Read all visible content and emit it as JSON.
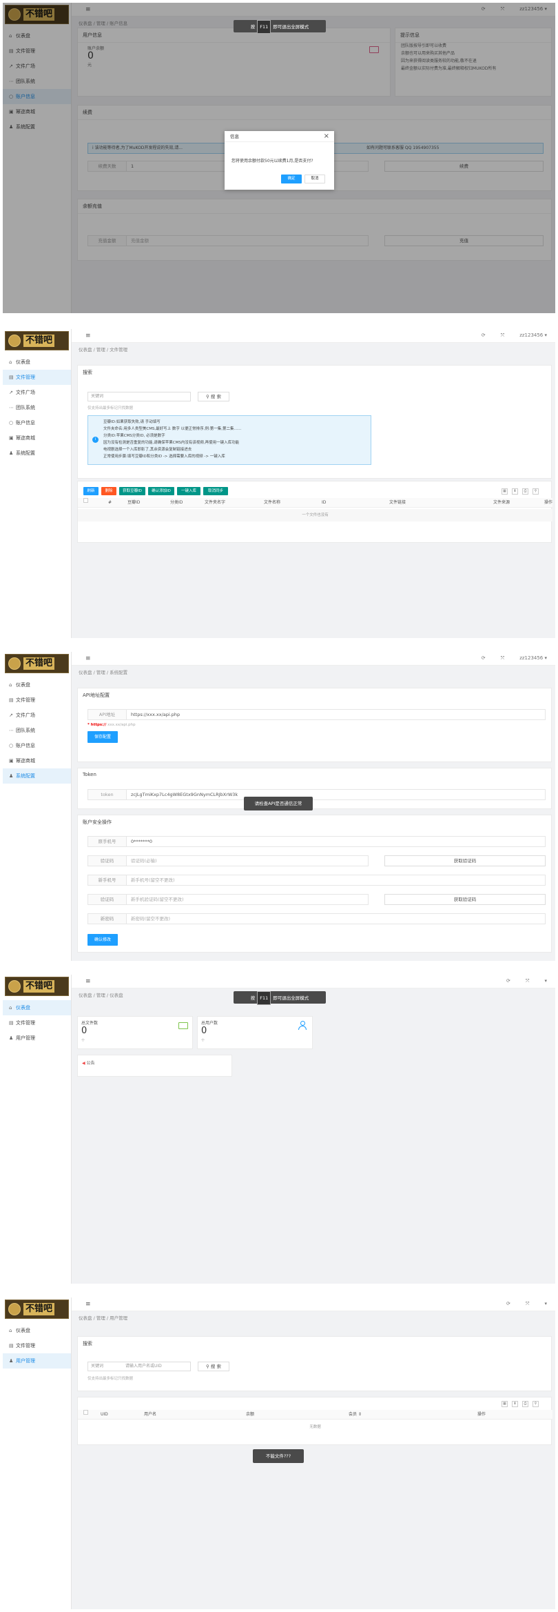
{
  "brand": {
    "logo_text": "不错吧",
    "logo_sub": "BUCUOBA.COM"
  },
  "topbar": {
    "menu_glyph": "≡",
    "refresh_glyph": "⟳",
    "fullscreen_glyph": "⤧",
    "user": "zz123456 ▾",
    "user_short": "▾"
  },
  "fullscreen_toast": {
    "pre": "按",
    "key": "F11",
    "post": "即可退出全屏模式"
  },
  "nav_full": [
    {
      "icon": "⌂",
      "label": "仪表盘"
    },
    {
      "icon": "▤",
      "label": "文件管理"
    },
    {
      "icon": "↗",
      "label": "文件广场"
    },
    {
      "icon": "⋯",
      "label": "团队系统"
    },
    {
      "icon": "○",
      "label": "账户信息"
    },
    {
      "icon": "▣",
      "label": "幂迩商城"
    },
    {
      "icon": "♟",
      "label": "系统配置"
    }
  ],
  "nav_short": [
    {
      "icon": "⌂",
      "label": "仪表盘"
    },
    {
      "icon": "▤",
      "label": "文件管理"
    },
    {
      "icon": "♟",
      "label": "用户管理"
    }
  ],
  "p1": {
    "crumb": "仪表盘 / 管理 / 账户信息",
    "user_info": {
      "title": "用户信息",
      "balance_label": "账户余额",
      "balance": "0",
      "unit": "元"
    },
    "tips": {
      "title": "提示信息",
      "lines": [
        "团队版按导引即可以收费",
        "余额也可以用来购买其他产品",
        "因为来获得阅读类服务较的功能,敬不在退",
        "最终金额以实际付费为准,最终解释权归MUKOD所有"
      ]
    },
    "recharge": {
      "title": "续费",
      "notice": "i  该功能等待者,为了MuKOD开发程说的失效,请...",
      "notice_tail": "如有问题可联系客服 QQ 1954907355",
      "row_label": "续费天数",
      "row_value": "1",
      "btn": "续费"
    },
    "balance_card": {
      "title": "余额充值",
      "row_label": "充值金额",
      "row_placeholder": "充值金额",
      "btn": "充值"
    },
    "dialog": {
      "title": "信息",
      "close": "×",
      "message": "您将使用余额付款50元以续费1月,是否支付?",
      "ok": "确定",
      "cancel": "取消"
    }
  },
  "p2": {
    "crumb": "仪表盘 / 管理 / 文件管理",
    "search_title": "搜索",
    "search_label": "关键词",
    "search_btn": "搜 索",
    "search_hint": "仅支持出最多标记只找数据",
    "info": [
      "豆瓣ID:如果获取失败,请 手动填写",
      "文件夹命名:用多人类型美CMS,最好写上 数字 以便正常排序,例:第一集,第二集……",
      "分类ID:苹果CMS分类ID, 必须是数字",
      "因为没有检测是否重复的功能,请确保苹果CMS内没有该视频,再使用一键入库功能",
      "电视剧选择一个入库即影了,其余资源会复制链接进去",
      "正常使用步骤:填写豆瓣ID和分类ID -> 选择需要入库的视频 -> 一键入库"
    ],
    "buttons": [
      "刷新",
      "删除",
      "获取豆瓣ID",
      "确认添加ID",
      "一键入库",
      "取消同步"
    ],
    "cols": [
      "#",
      "豆瓣ID",
      "分类ID",
      "文件夹名字",
      "文件名称",
      "ID",
      "文件链接",
      "文件来源",
      "操作"
    ],
    "empty": "一个文件也没有"
  },
  "p3": {
    "crumb": "仪表盘 / 管理 / 系统配置",
    "api": {
      "title": "API地址配置",
      "label": "API地址",
      "value": "https://xxx.xx/api.php",
      "hint_red": "* https://",
      "hint_rest": "xxx.xx/api.php",
      "btn": "保存配置"
    },
    "token": {
      "title": "Token",
      "label": "token",
      "value": "zcJLgTmiKxp7Lc4gW8EGtx9GnNymCLRJbXrW3k"
    },
    "toast": "请检查API是否通信正常",
    "account": {
      "title": "账户安全操作",
      "rows": [
        {
          "label": "原手机号",
          "value": "0*******0"
        },
        {
          "label": "验证码",
          "value": "验证码(必输)",
          "btn": "获取验证码"
        },
        {
          "label": "新手机号",
          "value": "新手机号(留空不更改)"
        },
        {
          "label": "验证码",
          "value": "新手机验证码(留空不更改)",
          "btn": "获取验证码"
        },
        {
          "label": "新密码",
          "value": "新密码(留空不更改)"
        }
      ],
      "btn": "确认修改"
    }
  },
  "p4": {
    "crumb": "仪表盘 / 管理 / 仪表盘",
    "stat1": {
      "title": "总文件数",
      "value": "0",
      "sub": "个"
    },
    "stat2": {
      "title": "总用户数",
      "value": "0",
      "sub": "个"
    },
    "notice": "公告"
  },
  "p5": {
    "crumb": "仪表盘 / 管理 / 用户管理",
    "search_title": "搜索",
    "search_label": "关键词",
    "search_placeholder": "请输入用户名或UID",
    "search_btn": "搜 索",
    "search_hint": "仅支持出最多标记只找数据",
    "cols": [
      "UID",
      "用户名",
      "余额",
      "会员 ⇕",
      "操作"
    ],
    "empty": "无数据",
    "toast": "不能文件???"
  },
  "colors": {
    "accent": "#1e9fff",
    "green": "#009688",
    "red": "#ff5722",
    "toast": "#4a4a4a"
  }
}
